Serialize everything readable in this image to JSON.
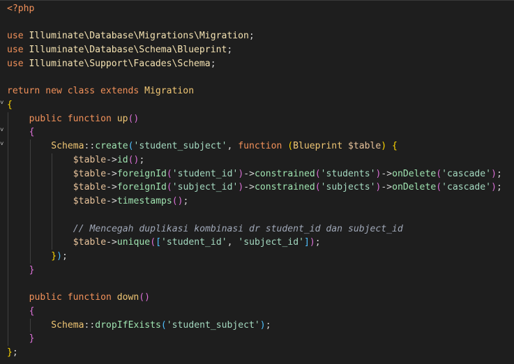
{
  "colors": {
    "background": "#1e1e1e",
    "keyword": "#e8c39b",
    "kw_orange": "#f2915a",
    "namespace": "#f4e2b2",
    "klass": "#f0c674",
    "func": "#9fe3b0",
    "string": "#a4d9c0",
    "variable": "#e8c39b",
    "punct": "#d4d4d4",
    "comment": "#a0a8b8",
    "bracket_yellow": "#ffd700",
    "bracket_purple": "#da70d6",
    "bracket_blue": "#4fc1ff"
  },
  "gutter_folds": [
    {
      "line": 8,
      "icon": "fold-chevron-icon"
    },
    {
      "line": 10,
      "icon": "fold-chevron-icon"
    },
    {
      "line": 11,
      "icon": "fold-chevron-icon"
    }
  ],
  "lines": [
    {
      "indent": 0,
      "tokens": [
        {
          "t": "<?php",
          "c": "kw_orange"
        }
      ]
    },
    {
      "indent": 0,
      "tokens": []
    },
    {
      "indent": 0,
      "tokens": [
        {
          "t": "use ",
          "c": "kw_orange"
        },
        {
          "t": "Illuminate\\Database\\Migrations\\Migration",
          "c": "namespace"
        },
        {
          "t": ";",
          "c": "punct"
        }
      ]
    },
    {
      "indent": 0,
      "tokens": [
        {
          "t": "use ",
          "c": "kw_orange"
        },
        {
          "t": "Illuminate\\Database\\Schema\\Blueprint",
          "c": "namespace"
        },
        {
          "t": ";",
          "c": "punct"
        }
      ]
    },
    {
      "indent": 0,
      "tokens": [
        {
          "t": "use ",
          "c": "kw_orange"
        },
        {
          "t": "Illuminate\\Support\\Facades\\Schema",
          "c": "namespace"
        },
        {
          "t": ";",
          "c": "punct"
        }
      ]
    },
    {
      "indent": 0,
      "tokens": []
    },
    {
      "indent": 0,
      "tokens": [
        {
          "t": "return ",
          "c": "kw_orange"
        },
        {
          "t": "new ",
          "c": "kw_orange"
        },
        {
          "t": "class ",
          "c": "kw_orange"
        },
        {
          "t": "extends ",
          "c": "kw_orange"
        },
        {
          "t": "Migration",
          "c": "klass"
        }
      ]
    },
    {
      "indent": 0,
      "tokens": [
        {
          "t": "{",
          "c": "bracket_yellow"
        }
      ]
    },
    {
      "indent": 1,
      "tokens": [
        {
          "t": "public ",
          "c": "kw_orange"
        },
        {
          "t": "function ",
          "c": "kw_orange"
        },
        {
          "t": "up",
          "c": "klass"
        },
        {
          "t": "()",
          "c": "bracket_purple"
        }
      ]
    },
    {
      "indent": 1,
      "tokens": [
        {
          "t": "{",
          "c": "bracket_purple"
        }
      ]
    },
    {
      "indent": 2,
      "tokens": [
        {
          "t": "Schema",
          "c": "klass"
        },
        {
          "t": "::",
          "c": "punct"
        },
        {
          "t": "create",
          "c": "func"
        },
        {
          "t": "(",
          "c": "bracket_blue"
        },
        {
          "t": "'student_subject'",
          "c": "string"
        },
        {
          "t": ", ",
          "c": "punct"
        },
        {
          "t": "function ",
          "c": "kw_orange"
        },
        {
          "t": "(",
          "c": "bracket_yellow"
        },
        {
          "t": "Blueprint ",
          "c": "klass"
        },
        {
          "t": "$table",
          "c": "variable"
        },
        {
          "t": ")",
          "c": "bracket_yellow"
        },
        {
          "t": " {",
          "c": "bracket_yellow"
        }
      ]
    },
    {
      "indent": 3,
      "tokens": [
        {
          "t": "$table",
          "c": "variable"
        },
        {
          "t": "->",
          "c": "punct"
        },
        {
          "t": "id",
          "c": "func"
        },
        {
          "t": "()",
          "c": "bracket_purple"
        },
        {
          "t": ";",
          "c": "punct"
        }
      ]
    },
    {
      "indent": 3,
      "tokens": [
        {
          "t": "$table",
          "c": "variable"
        },
        {
          "t": "->",
          "c": "punct"
        },
        {
          "t": "foreignId",
          "c": "func"
        },
        {
          "t": "(",
          "c": "bracket_purple"
        },
        {
          "t": "'student_id'",
          "c": "string"
        },
        {
          "t": ")",
          "c": "bracket_purple"
        },
        {
          "t": "->",
          "c": "punct"
        },
        {
          "t": "constrained",
          "c": "func"
        },
        {
          "t": "(",
          "c": "bracket_purple"
        },
        {
          "t": "'students'",
          "c": "string"
        },
        {
          "t": ")",
          "c": "bracket_purple"
        },
        {
          "t": "->",
          "c": "punct"
        },
        {
          "t": "onDelete",
          "c": "func"
        },
        {
          "t": "(",
          "c": "bracket_purple"
        },
        {
          "t": "'cascade'",
          "c": "string"
        },
        {
          "t": ")",
          "c": "bracket_purple"
        },
        {
          "t": ";",
          "c": "punct"
        }
      ]
    },
    {
      "indent": 3,
      "tokens": [
        {
          "t": "$table",
          "c": "variable"
        },
        {
          "t": "->",
          "c": "punct"
        },
        {
          "t": "foreignId",
          "c": "func"
        },
        {
          "t": "(",
          "c": "bracket_purple"
        },
        {
          "t": "'subject_id'",
          "c": "string"
        },
        {
          "t": ")",
          "c": "bracket_purple"
        },
        {
          "t": "->",
          "c": "punct"
        },
        {
          "t": "constrained",
          "c": "func"
        },
        {
          "t": "(",
          "c": "bracket_purple"
        },
        {
          "t": "'subjects'",
          "c": "string"
        },
        {
          "t": ")",
          "c": "bracket_purple"
        },
        {
          "t": "->",
          "c": "punct"
        },
        {
          "t": "onDelete",
          "c": "func"
        },
        {
          "t": "(",
          "c": "bracket_purple"
        },
        {
          "t": "'cascade'",
          "c": "string"
        },
        {
          "t": ")",
          "c": "bracket_purple"
        },
        {
          "t": ";",
          "c": "punct"
        }
      ]
    },
    {
      "indent": 3,
      "tokens": [
        {
          "t": "$table",
          "c": "variable"
        },
        {
          "t": "->",
          "c": "punct"
        },
        {
          "t": "timestamps",
          "c": "func"
        },
        {
          "t": "()",
          "c": "bracket_purple"
        },
        {
          "t": ";",
          "c": "punct"
        }
      ]
    },
    {
      "indent": 3,
      "tokens": []
    },
    {
      "indent": 3,
      "tokens": [
        {
          "t": "// Mencegah duplikasi kombinasi dr student_id dan subject_id",
          "c": "comment",
          "italic": true
        }
      ]
    },
    {
      "indent": 3,
      "tokens": [
        {
          "t": "$table",
          "c": "variable"
        },
        {
          "t": "->",
          "c": "punct"
        },
        {
          "t": "unique",
          "c": "func"
        },
        {
          "t": "(",
          "c": "bracket_purple"
        },
        {
          "t": "[",
          "c": "bracket_blue"
        },
        {
          "t": "'student_id'",
          "c": "string"
        },
        {
          "t": ", ",
          "c": "punct"
        },
        {
          "t": "'subject_id'",
          "c": "string"
        },
        {
          "t": "]",
          "c": "bracket_blue"
        },
        {
          "t": ")",
          "c": "bracket_purple"
        },
        {
          "t": ";",
          "c": "punct"
        }
      ]
    },
    {
      "indent": 2,
      "tokens": [
        {
          "t": "}",
          "c": "bracket_yellow"
        },
        {
          "t": ")",
          "c": "bracket_blue"
        },
        {
          "t": ";",
          "c": "punct"
        }
      ]
    },
    {
      "indent": 1,
      "tokens": [
        {
          "t": "}",
          "c": "bracket_purple"
        }
      ]
    },
    {
      "indent": 1,
      "tokens": []
    },
    {
      "indent": 1,
      "tokens": [
        {
          "t": "public ",
          "c": "kw_orange"
        },
        {
          "t": "function ",
          "c": "kw_orange"
        },
        {
          "t": "down",
          "c": "klass"
        },
        {
          "t": "()",
          "c": "bracket_purple"
        }
      ]
    },
    {
      "indent": 1,
      "tokens": [
        {
          "t": "{",
          "c": "bracket_purple"
        }
      ]
    },
    {
      "indent": 2,
      "tokens": [
        {
          "t": "Schema",
          "c": "klass"
        },
        {
          "t": "::",
          "c": "punct"
        },
        {
          "t": "dropIfExists",
          "c": "func"
        },
        {
          "t": "(",
          "c": "bracket_blue"
        },
        {
          "t": "'student_subject'",
          "c": "string"
        },
        {
          "t": ")",
          "c": "bracket_blue"
        },
        {
          "t": ";",
          "c": "punct"
        }
      ]
    },
    {
      "indent": 1,
      "tokens": [
        {
          "t": "}",
          "c": "bracket_purple"
        }
      ]
    },
    {
      "indent": 0,
      "tokens": [
        {
          "t": "}",
          "c": "bracket_yellow"
        },
        {
          "t": ";",
          "c": "punct"
        }
      ]
    }
  ]
}
